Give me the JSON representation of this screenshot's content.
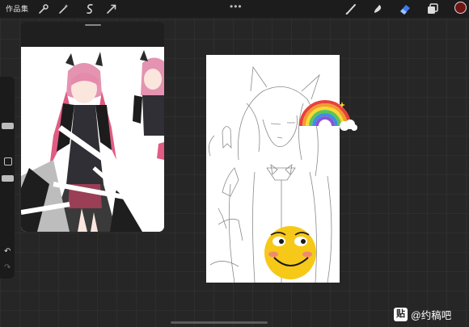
{
  "topbar": {
    "gallery_label": "作品集",
    "left_tools": [
      "wrench-icon",
      "magic-wand-icon",
      "selection-icon",
      "transform-arrow-icon"
    ],
    "more_dots": "•••",
    "right_tools": [
      "brush-icon",
      "smudge-icon",
      "eraser-icon",
      "layers-icon"
    ],
    "active_tool": "eraser-icon",
    "current_color": "#6e1514",
    "accent_color": "#3a7bf2"
  },
  "sidebar": {
    "undo_glyph": "↶",
    "redo_glyph": "↷"
  },
  "watermark": {
    "icon_text": "贴",
    "text": "@约稿吧"
  }
}
